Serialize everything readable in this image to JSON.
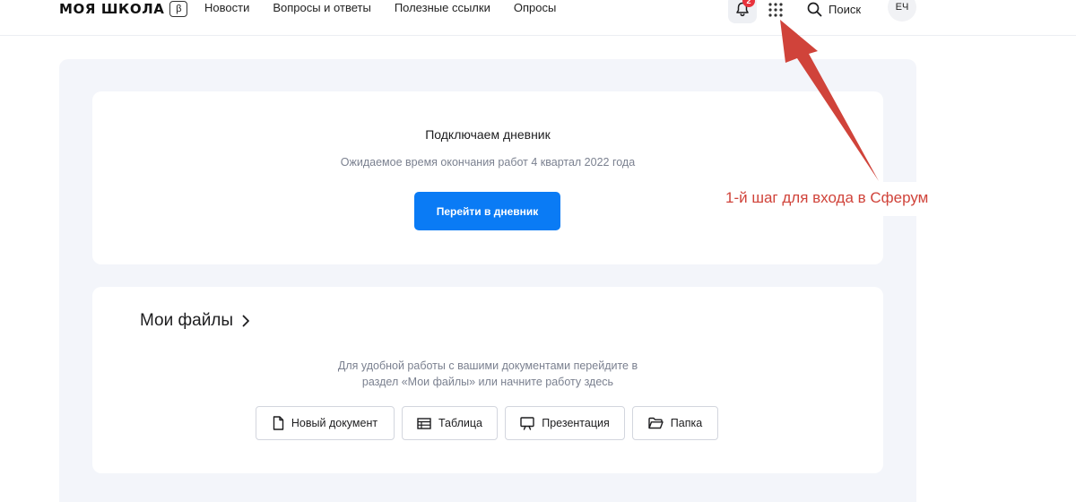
{
  "header": {
    "logo_text": "МОЯ ШКОЛА",
    "logo_badge": "β",
    "nav": [
      {
        "label": "Новости"
      },
      {
        "label": "Вопросы и ответы"
      },
      {
        "label": "Полезные ссылки"
      },
      {
        "label": "Опросы"
      }
    ],
    "notification_count": "2",
    "search_label": "Поиск",
    "avatar_initials": "ЕЧ"
  },
  "diary_card": {
    "title": "Подключаем дневник",
    "subtitle": "Ожидаемое время окончания работ 4 квартал 2022 года",
    "button_label": "Перейти в дневник"
  },
  "files_card": {
    "title": "Мои файлы",
    "description_line1": "Для удобной работы с вашими документами перейдите в",
    "description_line2": "раздел «Мои файлы» или начните работу здесь",
    "actions": [
      {
        "label": "Новый документ",
        "icon": "document-icon"
      },
      {
        "label": "Таблица",
        "icon": "table-icon"
      },
      {
        "label": "Презентация",
        "icon": "presentation-icon"
      },
      {
        "label": "Папка",
        "icon": "folder-icon"
      }
    ]
  },
  "annotation": {
    "label": "1-й шаг для входа в Сферум",
    "color": "#d0433a"
  },
  "colors": {
    "accent": "#0a7bf5",
    "badge": "#e8323c",
    "content_bg": "#f3f5fa"
  }
}
